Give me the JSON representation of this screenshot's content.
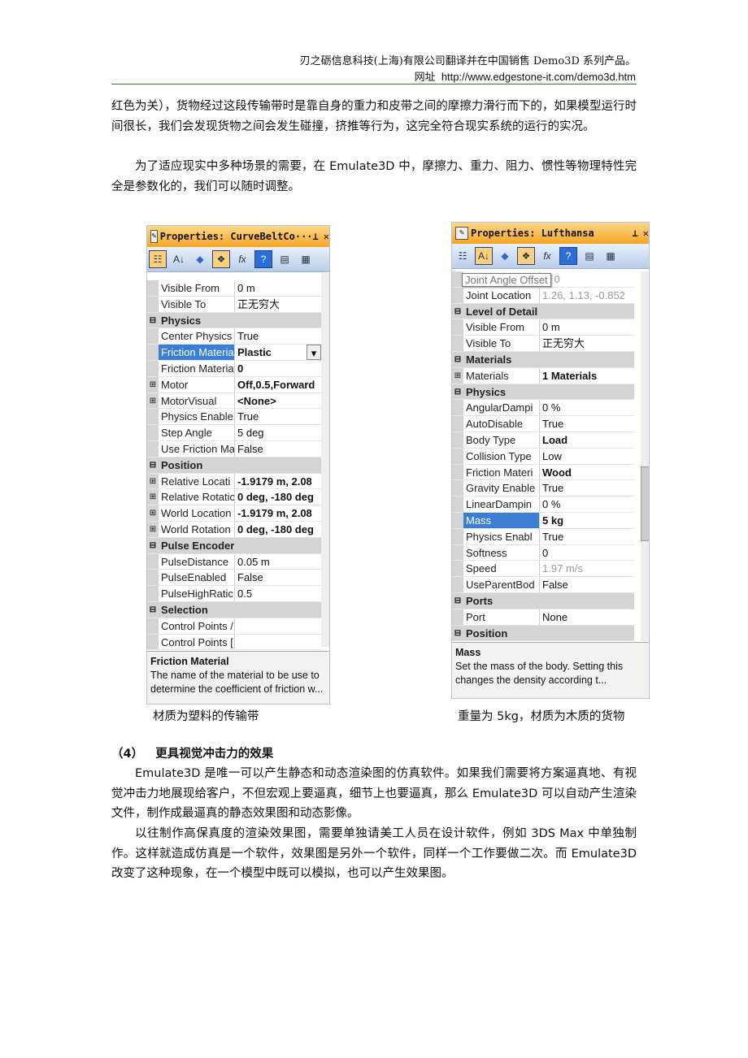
{
  "header": {
    "line1": "刃之砺信息科技(上海)有限公司翻译并在中国销售 Demo3D 系列产品。",
    "line2_label": "网址",
    "line2_url": "http://www.edgestone-it.com/demo3d.htm"
  },
  "paragraphs": [
    "红色为关），货物经过这段传输带时是靠自身的重力和皮带之间的摩擦力滑行而下的，如果模型运行时间很长，我们会发现货物之间会发生碰撞，挤推等行为，这完全符合现实系统的运行的实况。",
    "为了适应现实中多种场景的需要，在 Emulate3D 中，摩擦力、重力、阻力、惯性等物理特性完全是参数化的，我们可以随时调整。"
  ],
  "left_panel": {
    "title": "Properties: CurveBeltCo···",
    "rows": [
      {
        "name": "Visible From",
        "value": "0 m"
      },
      {
        "name": "Visible To",
        "value": "正无穷大"
      },
      {
        "category": "Physics"
      },
      {
        "name": "Center Physics",
        "value": "True"
      },
      {
        "name": "Friction Materia",
        "value": "Plastic",
        "bold": true,
        "selected": true,
        "dropdown": true
      },
      {
        "name": "Friction Materia",
        "value": "0",
        "bold": true
      },
      {
        "name": "Motor",
        "value": "Off,0.5,Forward",
        "bold": true,
        "expand": true
      },
      {
        "name": "MotorVisual",
        "value": "<None>",
        "bold": true,
        "expand": true
      },
      {
        "name": "Physics Enable",
        "value": "True"
      },
      {
        "name": "Step Angle",
        "value": "5 deg"
      },
      {
        "name": "Use Friction Ma",
        "value": "False"
      },
      {
        "category": "Position"
      },
      {
        "name": "Relative Locati",
        "value": "-1.9179 m, 2.08",
        "bold": true,
        "expand": true
      },
      {
        "name": "Relative Rotatic",
        "value": "0 deg, -180 deg",
        "bold": true,
        "expand": true
      },
      {
        "name": "World Location",
        "value": "-1.9179 m, 2.08",
        "bold": true,
        "expand": true
      },
      {
        "name": "World Rotation",
        "value": "0 deg, -180 deg",
        "bold": true,
        "expand": true
      },
      {
        "category": "Pulse Encoder"
      },
      {
        "name": "PulseDistance",
        "value": "0.05 m"
      },
      {
        "name": "PulseEnabled",
        "value": "False"
      },
      {
        "name": "PulseHighRatic",
        "value": "0.5"
      },
      {
        "category": "Selection"
      },
      {
        "name": "Control Points /",
        "value": ""
      },
      {
        "name": "Control Points [",
        "value": ""
      }
    ],
    "desc_title": "Friction Material",
    "desc_text": "The name of the material to be use to determine the coefficient of friction w..."
  },
  "right_panel": {
    "title": "Properties: Lufthansa",
    "tooltip": "Joint Angle Offset",
    "rows": [
      {
        "name": "Joint Angle Offset",
        "value": "0, 0",
        "disabled": true
      },
      {
        "name": "Joint Location",
        "value": "1.26, 1.13, -0.852",
        "disabled": true
      },
      {
        "category": "Level of Detail"
      },
      {
        "name": "Visible From",
        "value": "0 m"
      },
      {
        "name": "Visible To",
        "value": "正无穷大"
      },
      {
        "category": "Materials"
      },
      {
        "name": "Materials",
        "value": "1 Materials",
        "bold": true,
        "expand": true
      },
      {
        "category": "Physics"
      },
      {
        "name": "AngularDampi",
        "value": "0 %"
      },
      {
        "name": "AutoDisable",
        "value": "True"
      },
      {
        "name": "Body Type",
        "value": "Load",
        "bold": true
      },
      {
        "name": "Collision Type",
        "value": "Low"
      },
      {
        "name": "Friction Materi",
        "value": "Wood",
        "bold": true
      },
      {
        "name": "Gravity Enable",
        "value": "True"
      },
      {
        "name": "LinearDampin",
        "value": "0 %"
      },
      {
        "name": "Mass",
        "value": "5 kg",
        "bold": true,
        "selected": true
      },
      {
        "name": "Physics Enabl",
        "value": "True"
      },
      {
        "name": "Softness",
        "value": "0"
      },
      {
        "name": "Speed",
        "value": "1.97 m/s",
        "disabled": true
      },
      {
        "name": "UseParentBod",
        "value": "False"
      },
      {
        "category": "Ports"
      },
      {
        "name": "Port",
        "value": "None"
      },
      {
        "category": "Position"
      }
    ],
    "desc_title": "Mass",
    "desc_text": "Set the mass of the body. Setting this changes the density according t..."
  },
  "captions": {
    "left": "材质为塑料的传输带",
    "right": "重量为 5kg，材质为木质的货物"
  },
  "section": {
    "number": "（4）",
    "title": "更具视觉冲击力的效果"
  },
  "paragraphs2": [
    "Emulate3D 是唯一可以产生静态和动态渲染图的仿真软件。如果我们需要将方案逼真地、有视觉冲击力地展现给客户，不但宏观上要逼真，细节上也要逼真，那么 Emulate3D 可以自动产生渲染文件，制作成最逼真的静态效果图和动态影像。",
    "以往制作高保真度的渲染效果图，需要单独请美工人员在设计软件，例如 3DS Max 中单独制作。这样就造成仿真是一个软件，效果图是另外一个软件，同样一个工作要做二次。而 Emulate3D 改变了这种现象，在一个模型中既可以模拟，也可以产生效果图。"
  ]
}
